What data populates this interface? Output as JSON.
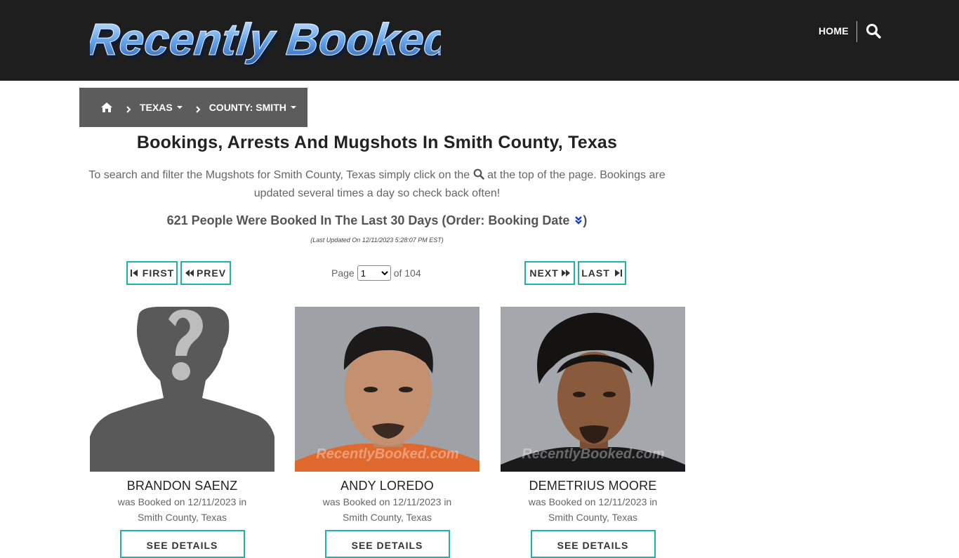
{
  "header": {
    "logo_text": "Recently Booked",
    "nav_home": "HOME",
    "search_icon": "search-icon"
  },
  "breadcrumb": {
    "home_icon": "home-icon",
    "items": [
      {
        "label": "TEXAS"
      },
      {
        "label": "COUNTY: SMITH"
      }
    ]
  },
  "main": {
    "title": "Bookings, Arrests And Mugshots In Smith County, Texas",
    "description_before": "To search and filter the Mugshots for Smith County, Texas simply click on the",
    "description_after": "at the top of the page. Bookings are updated several times a day so check back often!",
    "count_text": "621 People Were Booked In The Last 30 Days (Order: Booking Date",
    "count_close": ")",
    "last_updated": "(Last Updated On 12/11/2023 5:28:07 PM EST)"
  },
  "pagination": {
    "first": "FIRST",
    "prev": "PREV",
    "next": "NEXT",
    "last": "LAST",
    "page_label": "Page",
    "current_page": "1",
    "of_label": "of 104"
  },
  "bookings": [
    {
      "name": "BRANDON SAENZ",
      "line1": "was Booked on 12/11/2023 in",
      "line2": "Smith County, Texas",
      "button": "SEE DETAILS",
      "photo": "placeholder-silhouette"
    },
    {
      "name": "ANDY LOREDO",
      "line1": "was Booked on 12/11/2023 in",
      "line2": "Smith County, Texas",
      "button": "SEE DETAILS",
      "photo": "mugshot",
      "watermark": "RecentlyBooked.com"
    },
    {
      "name": "DEMETRIUS MOORE",
      "line1": "was Booked on 12/11/2023 in",
      "line2": "Smith County, Texas",
      "button": "SEE DETAILS",
      "photo": "mugshot",
      "watermark": "RecentlyBooked.com"
    }
  ],
  "colors": {
    "header_bg": "#1e1e1e",
    "breadcrumb_bg": "#5c5c5c",
    "accent_teal": "#1fb3a8",
    "logo_blue": "#6aa8ee"
  }
}
